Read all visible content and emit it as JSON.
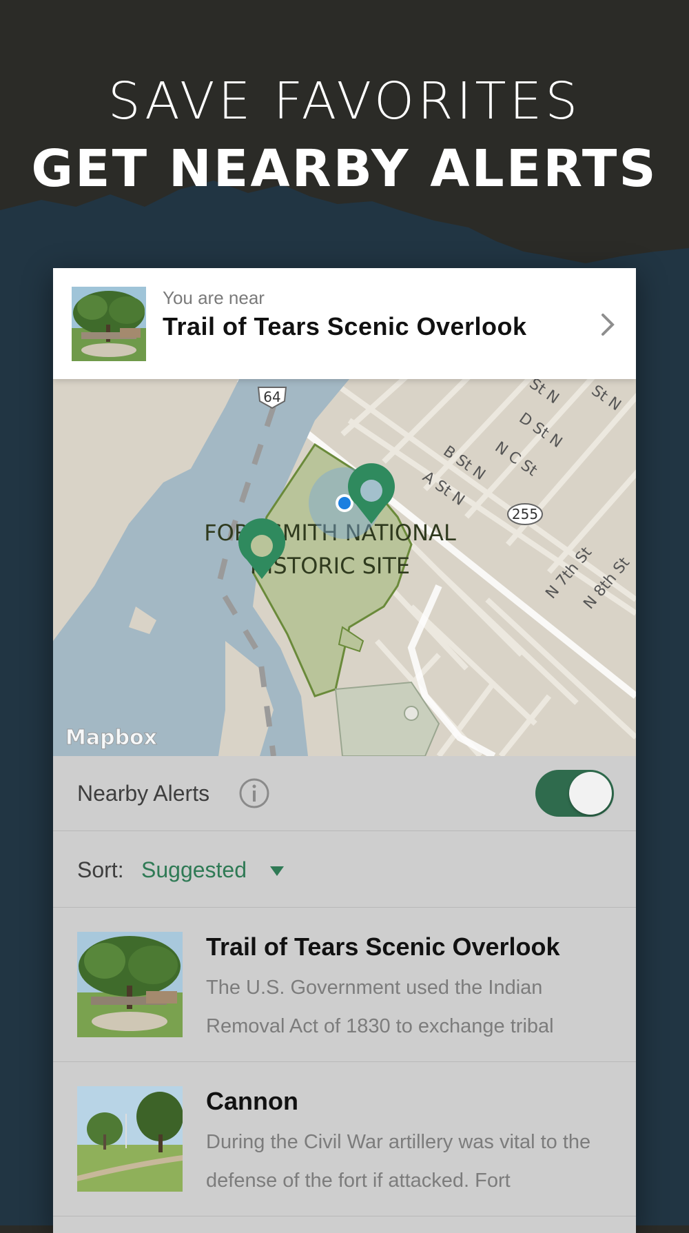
{
  "headline": {
    "line1": "SAVE FAVORITES",
    "line2": "GET NEARBY ALERTS"
  },
  "near_banner": {
    "subtitle": "You are near",
    "title": "Trail of Tears Scenic Overlook",
    "thumbnail_icon": "tree-photo",
    "chevron_icon": "chevron-right-icon"
  },
  "map": {
    "attribution": "Mapbox",
    "park_label_line1": "FORT SMITH NATIONAL",
    "park_label_line2": "HISTORIC SITE",
    "route_shields": [
      "64",
      "255"
    ],
    "street_labels": [
      "D St N",
      "N C St",
      "B St N",
      "A St N",
      "N 7th St",
      "N 8th St",
      "St N",
      "St N"
    ]
  },
  "alerts": {
    "label": "Nearby Alerts",
    "info_icon": "info-icon",
    "toggle_on": true
  },
  "sort": {
    "label": "Sort:",
    "value": "Suggested"
  },
  "list": [
    {
      "title": "Trail of Tears Scenic Overlook",
      "description": "The U.S. Government used the Indian Removal Act of 1830 to exchange tribal"
    },
    {
      "title": "Cannon",
      "description": "During the Civil War artillery was vital to the defense of the fort if attacked. Fort"
    }
  ],
  "colors": {
    "header_bg": "#2b2b27",
    "mountain": "#213543",
    "accent_green": "#2f7a55",
    "toggle_green": "#2f6b4d",
    "map_water": "#a3b8c4",
    "map_park": "#b9c49a"
  }
}
